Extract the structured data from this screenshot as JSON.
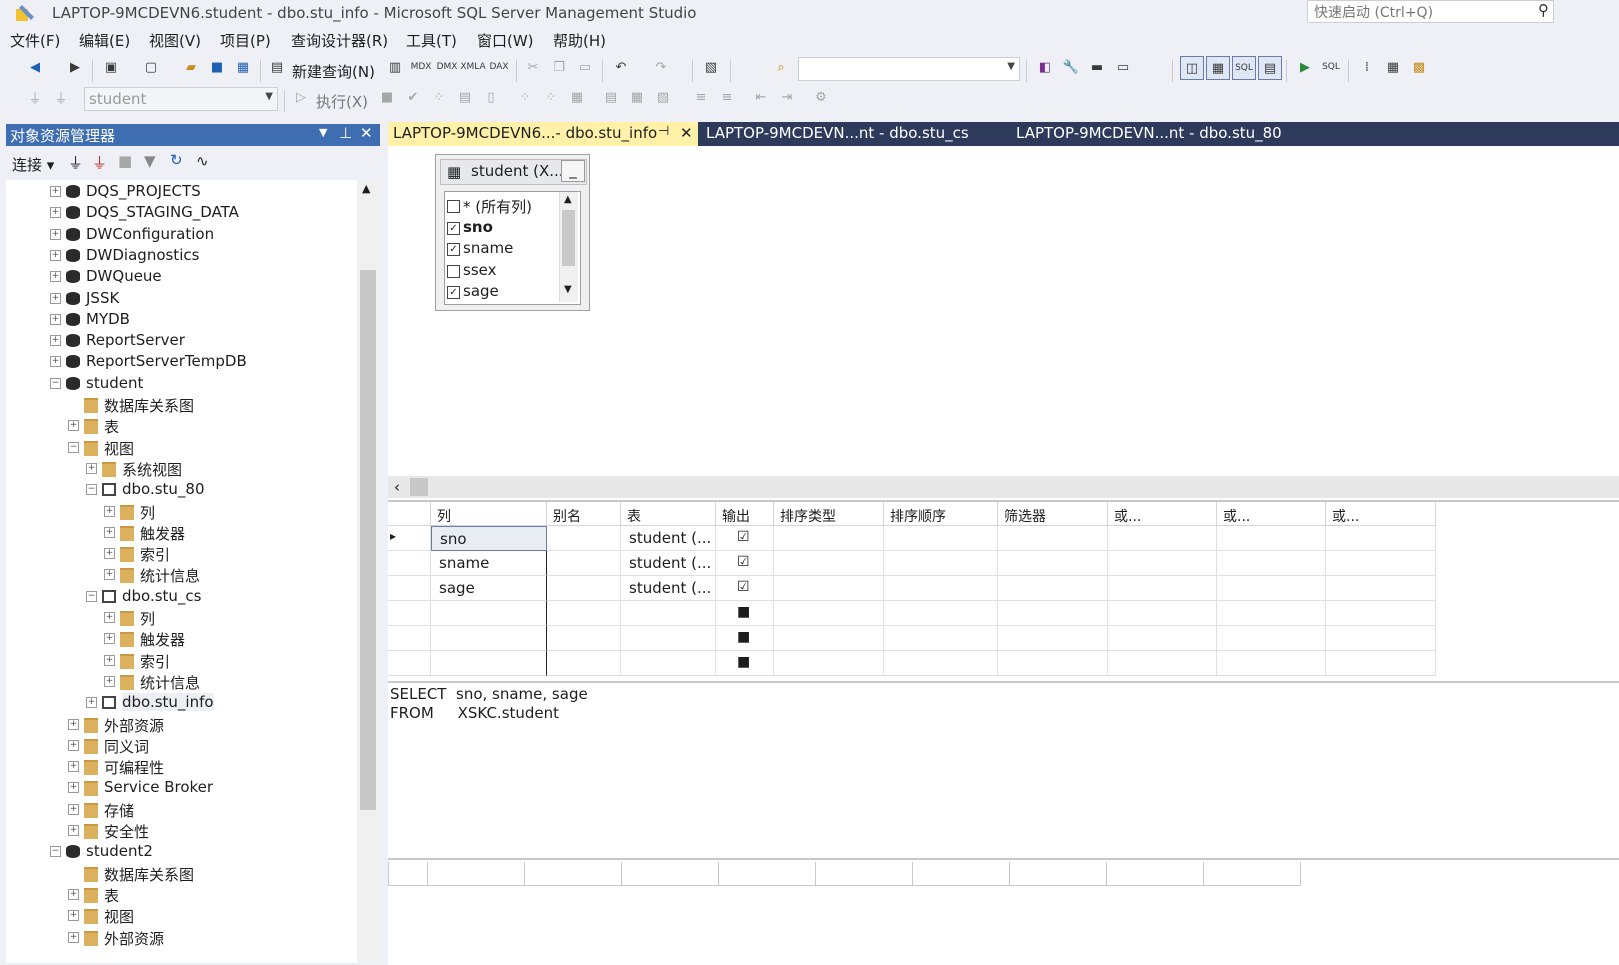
{
  "window": {
    "title": "LAPTOP-9MCDEVN6.student - dbo.stu_info - Microsoft SQL Server Management Studio",
    "quick_launch_placeholder": "快速启动 (Ctrl+Q)"
  },
  "menu": [
    "文件(F)",
    "编辑(E)",
    "视图(V)",
    "项目(P)",
    "查询设计器(R)",
    "工具(T)",
    "窗口(W)",
    "帮助(H)"
  ],
  "toolbar": {
    "new_query": "新建查询(N)",
    "db_selector": "student",
    "execute": "执行(X)",
    "search_combo": ""
  },
  "object_explorer": {
    "title": "对象资源管理器",
    "connect": "连接",
    "nodes": [
      "DQS_PROJECTS",
      "DQS_STAGING_DATA",
      "DWConfiguration",
      "DWDiagnostics",
      "DWQueue",
      "JSSK",
      "MYDB",
      "ReportServer",
      "ReportServerTempDB",
      "student",
      "数据库关系图",
      "表",
      "视图",
      "系统视图",
      "dbo.stu_80",
      "列",
      "触发器",
      "索引",
      "统计信息",
      "dbo.stu_cs",
      "列",
      "触发器",
      "索引",
      "统计信息",
      "dbo.stu_info",
      "外部资源",
      "同义词",
      "可编程性",
      "Service Broker",
      "存储",
      "安全性",
      "student2",
      "数据库关系图",
      "表",
      "视图",
      "外部资源"
    ]
  },
  "tabs": [
    {
      "label": "LAPTOP-9MCDEVN6...- dbo.stu_info"
    },
    {
      "label": "LAPTOP-9MCDEVN...nt - dbo.stu_cs"
    },
    {
      "label": "LAPTOP-9MCDEVN...nt - dbo.stu_80"
    }
  ],
  "diagram": {
    "table_title": "student (X...",
    "columns": [
      {
        "name": "* (所有列)",
        "checked": false
      },
      {
        "name": "sno",
        "checked": true
      },
      {
        "name": "sname",
        "checked": true
      },
      {
        "name": "ssex",
        "checked": false
      },
      {
        "name": "sage",
        "checked": true
      }
    ]
  },
  "grid": {
    "headers": [
      "列",
      "别名",
      "表",
      "输出",
      "排序类型",
      "排序顺序",
      "筛选器",
      "或...",
      "或...",
      "或..."
    ],
    "rows": [
      {
        "column": "sno",
        "alias": "",
        "table": "student (...",
        "output": "☑"
      },
      {
        "column": "sname",
        "alias": "",
        "table": "student (...",
        "output": "☑"
      },
      {
        "column": "sage",
        "alias": "",
        "table": "student (...",
        "output": "☑"
      },
      {
        "column": "",
        "alias": "",
        "table": "",
        "output": "■"
      },
      {
        "column": "",
        "alias": "",
        "table": "",
        "output": "■"
      },
      {
        "column": "",
        "alias": "",
        "table": "",
        "output": "■"
      }
    ]
  },
  "sql": {
    "line1": "SELECT  sno, sname, sage",
    "line2": "FROM     XSKC.student"
  }
}
